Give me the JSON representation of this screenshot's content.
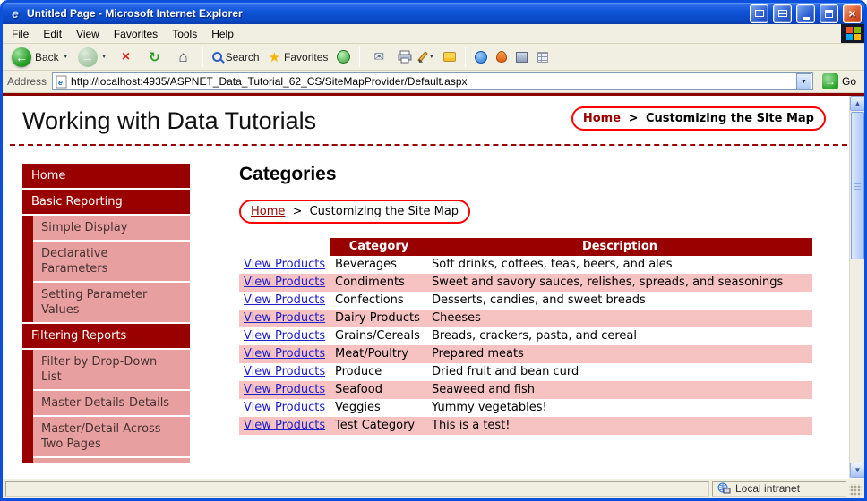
{
  "window": {
    "title": "Untitled Page - Microsoft Internet Explorer"
  },
  "menu": {
    "items": [
      "File",
      "Edit",
      "View",
      "Favorites",
      "Tools",
      "Help"
    ]
  },
  "toolbar": {
    "back_label": "Back",
    "search_label": "Search",
    "favorites_label": "Favorites"
  },
  "address": {
    "label": "Address",
    "url": "http://localhost:4935/ASPNET_Data_Tutorial_62_CS/SiteMapProvider/Default.aspx",
    "go_label": "Go"
  },
  "icons": {
    "back_arrow": "←",
    "forward_arrow": "→",
    "stop": "×",
    "refresh": "↻",
    "home": "⌂",
    "mail": "✉",
    "star": "★",
    "caret": "▼",
    "go_arrow": "→",
    "scroll_up": "▲",
    "scroll_down": "▼",
    "close": "×"
  },
  "page": {
    "title": "Working with Data Tutorials",
    "breadcrumb_top": {
      "home": "Home",
      "sep": ">",
      "current": "Customizing the Site Map"
    },
    "content": {
      "heading": "Categories",
      "breadcrumb": {
        "home": "Home",
        "sep": ">",
        "current": "Customizing the Site Map"
      }
    },
    "sidebar": [
      "Home",
      "Basic Reporting",
      "Simple Display",
      "Declarative Parameters",
      "Setting Parameter Values",
      "Filtering Reports",
      "Filter by Drop-Down List",
      "Master-Details-Details",
      "Master/Detail Across Two Pages"
    ],
    "table": {
      "headers": {
        "category": "Category",
        "description": "Description"
      },
      "link_label": "View Products",
      "rows": [
        {
          "category": "Beverages",
          "description": "Soft drinks, coffees, teas, beers, and ales"
        },
        {
          "category": "Condiments",
          "description": "Sweet and savory sauces, relishes, spreads, and seasonings"
        },
        {
          "category": "Confections",
          "description": "Desserts, candies, and sweet breads"
        },
        {
          "category": "Dairy Products",
          "description": "Cheeses"
        },
        {
          "category": "Grains/Cereals",
          "description": "Breads, crackers, pasta, and cereal"
        },
        {
          "category": "Meat/Poultry",
          "description": "Prepared meats"
        },
        {
          "category": "Produce",
          "description": "Dried fruit and bean curd"
        },
        {
          "category": "Seafood",
          "description": "Seaweed and fish"
        },
        {
          "category": "Veggies",
          "description": "Yummy vegetables!"
        },
        {
          "category": "Test Category",
          "description": "This is a test!"
        }
      ]
    }
  },
  "statusbar": {
    "zone": "Local intranet"
  },
  "colors": {
    "maroon": "#990000",
    "sidebar_pink": "#e79f9f",
    "row_pink": "#f6c2c2",
    "annotation_red": "#ff0000",
    "link_blue": "#2121cc",
    "titlebar_blue": "#0c50dd"
  }
}
